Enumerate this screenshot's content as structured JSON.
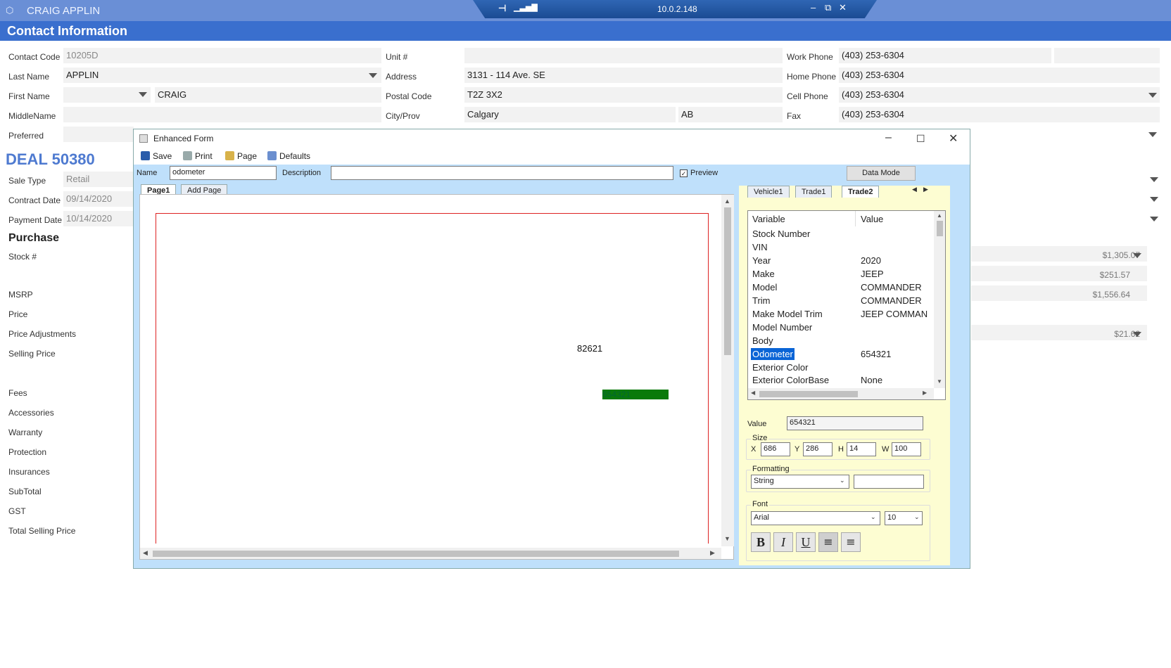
{
  "app": {
    "user_title": "CRAIG APPLIN",
    "page_header": "Contact Information"
  },
  "remote": {
    "ip": "10.0.2.148"
  },
  "contact": {
    "labels": {
      "contact_code": "Contact Code",
      "last_name": "Last Name",
      "first_name": "First Name",
      "middle_name": "MiddleName",
      "preferred": "Preferred",
      "unit": "Unit #",
      "address": "Address",
      "postal_code": "Postal Code",
      "city_prov": "City/Prov",
      "work_phone": "Work Phone",
      "home_phone": "Home Phone",
      "cell_phone": "Cell Phone",
      "fax": "Fax"
    },
    "values": {
      "contact_code": "10205D",
      "last_name": "APPLIN",
      "first_name": "CRAIG",
      "middle_name": "",
      "preferred": "",
      "unit": "",
      "address": "3131 - 114 Ave. SE",
      "postal_code": "T2Z 3X2",
      "city": "Calgary",
      "prov": "AB",
      "work_phone": "(403) 253-6304",
      "home_phone": "(403) 253-6304",
      "cell_phone": "(403) 253-6304",
      "fax": "(403) 253-6304"
    }
  },
  "deal": {
    "title": "DEAL 50380",
    "labels": {
      "sale_type": "Sale Type",
      "contract_date": "Contract Date",
      "payment_date": "Payment Date"
    },
    "values": {
      "sale_type": "Retail",
      "contract_date": "09/14/2020",
      "payment_date": "10/14/2020"
    },
    "purchase_title": "Purchase",
    "rows": [
      "Stock #",
      "MSRP",
      "Price",
      "Price Adjustments",
      "Selling Price",
      "Fees",
      "Accessories",
      "Warranty",
      "Protection",
      "Insurances",
      "SubTotal",
      "GST",
      "Total Selling Price"
    ],
    "right_amounts": [
      "$1,305.07",
      "$251.57",
      "$1,556.64",
      "$21.62"
    ]
  },
  "form": {
    "title": "Enhanced Form",
    "toolbar": {
      "save": "Save",
      "print": "Print",
      "page": "Page",
      "defaults": "Defaults"
    },
    "name_label": "Name",
    "name_value": "odometer",
    "description_label": "Description",
    "description_value": "",
    "preview_label": "Preview",
    "data_mode": "Data Mode",
    "tabs": [
      "Page1",
      "Add Page"
    ],
    "canvas_text": "82621",
    "canvas_selected": "654321",
    "var_tabs": [
      "Vehicle1",
      "Trade1",
      "Trade2"
    ],
    "grid_header": {
      "variable": "Variable",
      "value": "Value"
    },
    "grid_rows": [
      {
        "variable": "Stock Number",
        "value": ""
      },
      {
        "variable": "VIN",
        "value": ""
      },
      {
        "variable": "Year",
        "value": "2020"
      },
      {
        "variable": "Make",
        "value": "JEEP"
      },
      {
        "variable": "Model",
        "value": "COMMANDER"
      },
      {
        "variable": "Trim",
        "value": "COMMANDER"
      },
      {
        "variable": "Make Model Trim",
        "value": "JEEP COMMAN"
      },
      {
        "variable": "Model Number",
        "value": ""
      },
      {
        "variable": "Body",
        "value": ""
      },
      {
        "variable": "Odometer",
        "value": "654321"
      },
      {
        "variable": "Exterior Color",
        "value": ""
      },
      {
        "variable": "Exterior ColorBase",
        "value": "None"
      }
    ],
    "value_label": "Value",
    "value_value": "654321",
    "size_label": "Size",
    "x_label": "X",
    "x_value": "686",
    "y_label": "Y",
    "y_value": "286",
    "h_label": "H",
    "h_value": "14",
    "w_label": "W",
    "w_value": "100",
    "formatting_label": "Formatting",
    "format_value": "String",
    "format_extra": "",
    "font_label": "Font",
    "font_value": "Arial",
    "font_size": "10",
    "fmt_bold": "B",
    "fmt_italic": "I",
    "fmt_underline": "U"
  }
}
